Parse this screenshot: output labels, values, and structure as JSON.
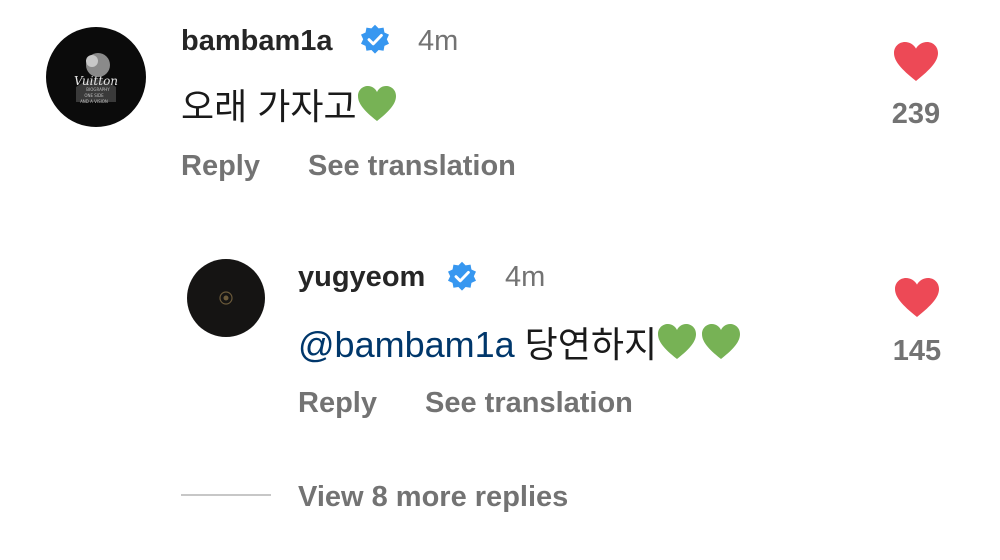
{
  "comments": [
    {
      "username": "bambam1a",
      "time": "4m",
      "text": "오래 가자고",
      "emoji": "green-heart-emoji",
      "likes": "239",
      "reply_label": "Reply",
      "translate_label": "See translation",
      "avatar_text": [
        "Vuitton",
        "BIOGRAPHY",
        "ONE SIDE",
        "AND A VISION"
      ]
    },
    {
      "username": "yugyeom",
      "time": "4m",
      "mention": "@bambam1a",
      "text": "당연하지",
      "emoji": "green-heart-emoji",
      "likes": "145",
      "reply_label": "Reply",
      "translate_label": "See translation"
    }
  ],
  "view_more_replies": "View 8 more replies",
  "colors": {
    "like_heart": "#ed4956",
    "verified_badge": "#3797f0",
    "mention": "#00376b",
    "green_heart": "#77b255",
    "secondary_text": "#737373"
  }
}
